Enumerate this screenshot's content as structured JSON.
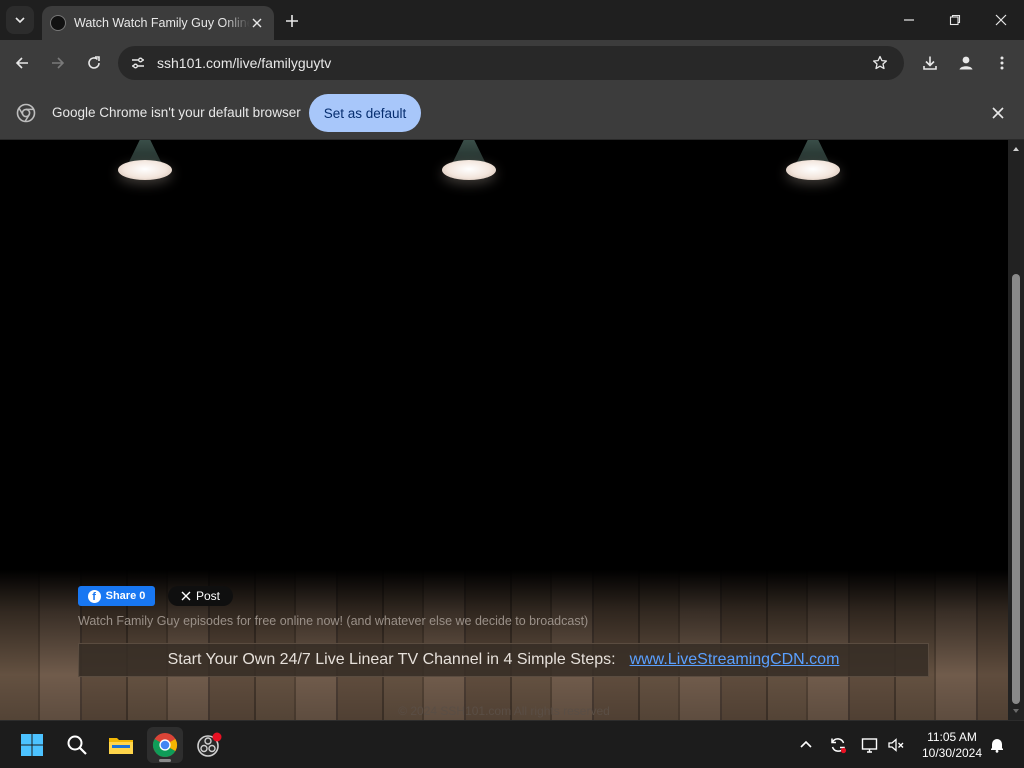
{
  "browser": {
    "tab": {
      "title": "Watch Watch Family Guy Online"
    },
    "url": "ssh101.com/live/familyguytv",
    "infobar": {
      "message": "Google Chrome isn't your default browser",
      "button_label": "Set as default"
    }
  },
  "page": {
    "share_button_label": "Share 0",
    "post_button_label": "Post",
    "tagline": "Watch Family Guy episodes for free online now! (and whatever else we decide to broadcast)",
    "promo_text": "Start Your Own 24/7 Live Linear TV Channel in 4 Simple Steps:",
    "promo_link": "www.LiveStreamingCDN.com",
    "copyright": "© 2024 SSH101.com All rights reserved"
  },
  "taskbar": {
    "time": "11:05 AM",
    "date": "10/30/2024"
  },
  "colors": {
    "accent_button": "#a8c7fa",
    "facebook_blue": "#1877f2",
    "link_blue": "#5aa0ff"
  },
  "icons": [
    "tab-search-icon",
    "favicon-icon",
    "close-icon",
    "plus-icon",
    "minimize-icon",
    "restore-icon",
    "back-arrow-icon",
    "forward-arrow-icon",
    "reload-icon",
    "site-info-icon",
    "star-icon",
    "download-icon",
    "profile-icon",
    "kebab-menu-icon",
    "chrome-logo-icon",
    "facebook-icon",
    "x-logo-icon",
    "windows-start-icon",
    "search-icon",
    "file-explorer-icon",
    "chrome-icon",
    "obs-icon",
    "chevron-up-icon",
    "sync-icon",
    "network-icon",
    "speaker-muted-icon",
    "bell-icon"
  ]
}
